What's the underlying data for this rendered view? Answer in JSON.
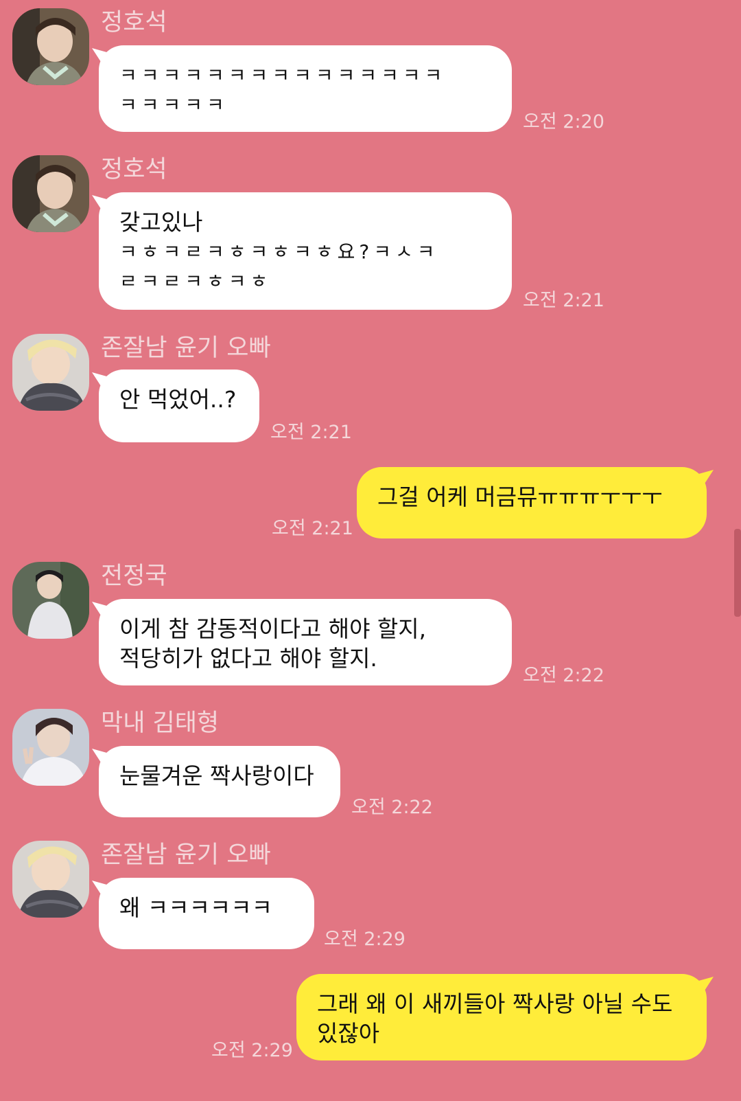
{
  "messages": [
    {
      "sender": "정호석",
      "lines": [
        "ㅋㅋㅋㅋㅋㅋㅋㅋㅋㅋㅋㅋㅋㅋㅋ",
        "ㅋㅋㅋㅋㅋ"
      ],
      "time": "오전 2:20"
    },
    {
      "sender": "정호석",
      "lines": [
        "갖고있나",
        "ㅋㅎㅋㄹㅋㅎㅋㅎㅋㅎ요?ㅋㅅㅋ",
        "ㄹㅋㄹㅋㅎㅋㅎ"
      ],
      "time": "오전 2:21"
    },
    {
      "sender": "존잘남 윤기 오빠",
      "lines": [
        "안 먹었어..?"
      ],
      "time": "오전 2:21"
    },
    {
      "lines": [
        "그걸 어케 머금뮤ㅠㅠㅠㅜㅜㅜ"
      ],
      "time": "오전 2:21"
    },
    {
      "sender": "전정국",
      "lines": [
        "이게 참 감동적이다고 해야 할지,",
        "적당히가 없다고 해야 할지."
      ],
      "time": "오전 2:22"
    },
    {
      "sender": "막내 김태형",
      "lines": [
        "눈물겨운 짝사랑이다"
      ],
      "time": "오전 2:22"
    },
    {
      "sender": "존잘남 윤기 오빠",
      "lines": [
        "왜 ㅋㅋㅋㅋㅋㅋ"
      ],
      "time": "오전 2:29"
    },
    {
      "lines": [
        "그래 왜 이 새끼들아 짝사랑 아닐 수도",
        "있잖아"
      ],
      "time": "오전 2:29"
    }
  ],
  "colors": {
    "background": "#e27683",
    "incoming_bubble": "#ffffff",
    "outgoing_bubble": "#ffec3a",
    "meta_text": "#f4d7da"
  },
  "icons": [
    "avatar-hoseok",
    "avatar-yoongi",
    "avatar-jungkook",
    "avatar-taehyung"
  ]
}
